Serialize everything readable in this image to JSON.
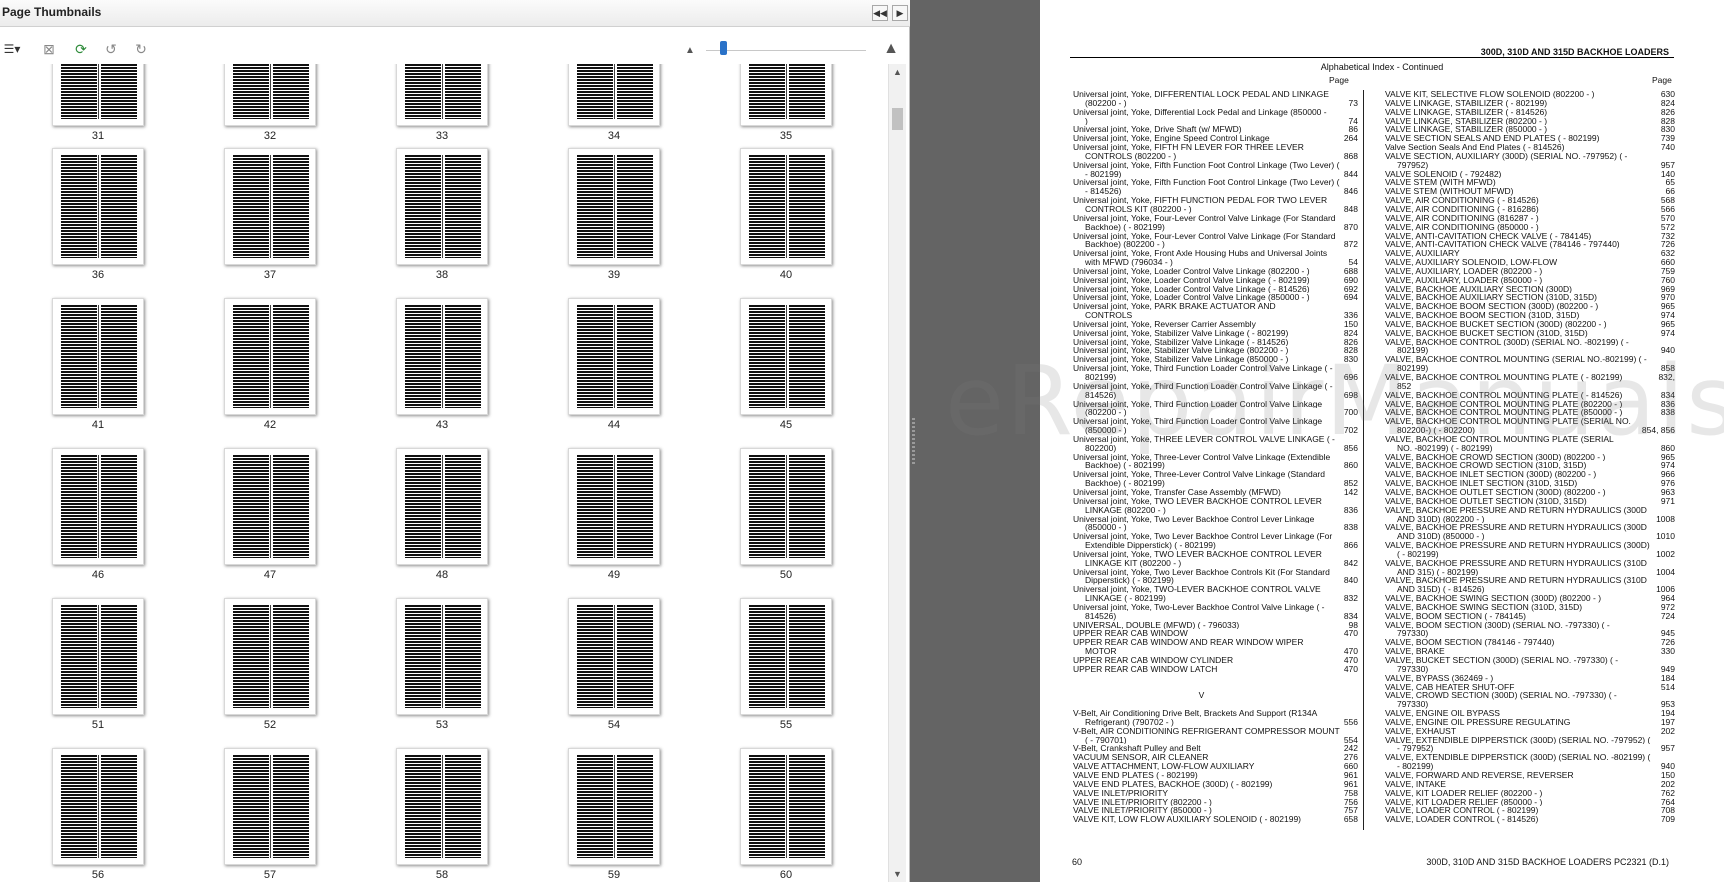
{
  "thumbnails_panel": {
    "title": "Page Thumbnails",
    "nav_left": "◀◀",
    "nav_right": "▶",
    "toolbar": [
      {
        "name": "options-menu-icon",
        "glyph": "☰▾"
      },
      {
        "name": "delete-pages-icon",
        "glyph": "⊠"
      },
      {
        "name": "insert-pages-icon",
        "glyph": "⟳"
      },
      {
        "name": "rotate-left-icon",
        "glyph": "↺"
      },
      {
        "name": "rotate-right-icon",
        "glyph": "↻"
      }
    ],
    "zoom_small_icon": "▲",
    "zoom_large_icon": "▲",
    "rows": [
      [
        "31",
        "32",
        "33",
        "34",
        "35"
      ],
      [
        "36",
        "37",
        "38",
        "39",
        "40"
      ],
      [
        "41",
        "42",
        "43",
        "44",
        "45"
      ],
      [
        "46",
        "47",
        "48",
        "49",
        "50"
      ],
      [
        "51",
        "52",
        "53",
        "54",
        "55"
      ],
      [
        "56",
        "57",
        "58",
        "59",
        "60"
      ]
    ]
  },
  "document": {
    "header": "300D, 310D AND 315D BACKHOE LOADERS",
    "subheader": "Alphabetical Index - Continued",
    "page_label": "Page",
    "footer_left": "60",
    "footer_right": "300D, 310D AND 315D BACKHOE LOADERS    PC2321    (D.1)",
    "watermark": "eRepairManuals",
    "left_column": [
      {
        "t": "Universal joint, Yoke, DIFFERENTIAL LOCK PEDAL AND LINKAGE",
        "p": ""
      },
      {
        "t": "(802200 - )",
        "p": "73",
        "c": true
      },
      {
        "t": "Universal joint, Yoke, Differential Lock Pedal and Linkage (850000 -",
        "p": ""
      },
      {
        "t": ")",
        "p": "74",
        "c": true
      },
      {
        "t": "Universal joint, Yoke, Drive Shaft (w/ MFWD)",
        "p": "86"
      },
      {
        "t": "Universal joint, Yoke, Engine Speed Control Linkage",
        "p": "264"
      },
      {
        "t": "Universal joint, Yoke, FIFTH FN LEVER FOR THREE LEVER",
        "p": ""
      },
      {
        "t": "CONTROLS (802200 - )",
        "p": "868",
        "c": true
      },
      {
        "t": "Universal joint, Yoke, Fifth Function Foot Control Linkage (Two Lever) (",
        "p": ""
      },
      {
        "t": "- 802199)",
        "p": "844",
        "c": true
      },
      {
        "t": "Universal joint, Yoke, Fifth Function Foot Control Linkage (Two Lever) (",
        "p": ""
      },
      {
        "t": "- 814526)",
        "p": "846",
        "c": true
      },
      {
        "t": "Universal joint, Yoke, FIFTH FUNCTION PEDAL FOR TWO LEVER",
        "p": ""
      },
      {
        "t": "CONTROLS KIT (802200 - )",
        "p": "848",
        "c": true
      },
      {
        "t": "Universal joint, Yoke, Four-Lever Control Valve Linkage (For Standard",
        "p": ""
      },
      {
        "t": "Backhoe) ( - 802199)",
        "p": "870",
        "c": true
      },
      {
        "t": "Universal joint, Yoke, Four-Lever Control Valve Linkage (For Standard",
        "p": ""
      },
      {
        "t": "Backhoe) (802200 - )",
        "p": "872",
        "c": true
      },
      {
        "t": "Universal joint, Yoke, Front Axle Housing Hubs and Universal Joints",
        "p": ""
      },
      {
        "t": "with MFWD (796034 - )",
        "p": "54",
        "c": true
      },
      {
        "t": "Universal joint, Yoke, Loader Control Valve Linkage (802200 - )",
        "p": "688"
      },
      {
        "t": "Universal joint, Yoke, Loader Control Valve Linkage ( - 802199)",
        "p": "690"
      },
      {
        "t": "Universal joint, Yoke, Loader Control Valve Linkage ( - 814526)",
        "p": "692"
      },
      {
        "t": "Universal joint, Yoke, Loader Control Valve Linkage (850000 - )",
        "p": "694"
      },
      {
        "t": "Universal joint, Yoke, PARK BRAKE ACTUATOR AND",
        "p": ""
      },
      {
        "t": "CONTROLS",
        "p": "336",
        "c": true
      },
      {
        "t": "Universal joint, Yoke, Reverser Carrier Assembly",
        "p": "150"
      },
      {
        "t": "Universal joint, Yoke, Stabilizer Valve Linkage ( - 802199)",
        "p": "824"
      },
      {
        "t": "Universal joint, Yoke, Stabilizer Valve Linkage ( - 814526)",
        "p": "826"
      },
      {
        "t": "Universal joint, Yoke, Stabilizer Valve Linkage (802200 - )",
        "p": "828"
      },
      {
        "t": "Universal joint, Yoke, Stabilizer Valve Linkage (850000 - )",
        "p": "830"
      },
      {
        "t": "Universal joint, Yoke, Third Function Loader Control Valve Linkage ( -",
        "p": ""
      },
      {
        "t": "802199)",
        "p": "696",
        "c": true
      },
      {
        "t": "Universal joint, Yoke, Third Function Loader Control Valve Linkage ( -",
        "p": ""
      },
      {
        "t": "814526)",
        "p": "698",
        "c": true
      },
      {
        "t": "Universal joint, Yoke, Third Function Loader Control Valve Linkage",
        "p": ""
      },
      {
        "t": "(802200 - )",
        "p": "700",
        "c": true
      },
      {
        "t": "Universal joint, Yoke, Third Function Loader Control Valve Linkage",
        "p": ""
      },
      {
        "t": "(850000 - )",
        "p": "702",
        "c": true
      },
      {
        "t": "Universal joint, Yoke, THREE LEVER CONTROL VALVE LINKAGE ( -",
        "p": ""
      },
      {
        "t": "802200)",
        "p": "856",
        "c": true
      },
      {
        "t": "Universal joint, Yoke, Three-Lever Control Valve Linkage (Extendible",
        "p": ""
      },
      {
        "t": "Backhoe) ( - 802199)",
        "p": "860",
        "c": true
      },
      {
        "t": "Universal joint, Yoke, Three-Lever Control Valve Linkage (Standard",
        "p": ""
      },
      {
        "t": "Backhoe) ( - 802199)",
        "p": "852",
        "c": true
      },
      {
        "t": "Universal joint, Yoke, Transfer Case Assembly (MFWD)",
        "p": "142"
      },
      {
        "t": "Universal joint, Yoke, TWO LEVER BACKHOE CONTROL LEVER",
        "p": ""
      },
      {
        "t": "LINKAGE (802200 - )",
        "p": "836",
        "c": true
      },
      {
        "t": "Universal joint, Yoke, Two Lever Backhoe Control Lever Linkage",
        "p": ""
      },
      {
        "t": "(850000 - )",
        "p": "838",
        "c": true
      },
      {
        "t": "Universal joint, Yoke, Two Lever Backhoe Control Lever Linkage (For",
        "p": ""
      },
      {
        "t": "Extendible Dipperstick) ( - 802199)",
        "p": "866",
        "c": true
      },
      {
        "t": "Universal joint, Yoke, TWO LEVER BACKHOE CONTROL LEVER",
        "p": ""
      },
      {
        "t": "LINKAGE KIT (802200 - )",
        "p": "842",
        "c": true
      },
      {
        "t": "Universal joint, Yoke, Two Lever Backhoe Controls Kit (For Standard",
        "p": ""
      },
      {
        "t": "Dipperstick) ( - 802199)",
        "p": "840",
        "c": true
      },
      {
        "t": "Universal joint, Yoke, TWO-LEVER BACKHOE CONTROL VALVE",
        "p": ""
      },
      {
        "t": "LINKAGE ( - 802199)",
        "p": "832",
        "c": true
      },
      {
        "t": "Universal joint, Yoke, Two-Lever Backhoe Control Valve Linkage ( -",
        "p": ""
      },
      {
        "t": "814526)",
        "p": "834",
        "c": true
      },
      {
        "t": "UNIVERSAL, DOUBLE (MFWD) ( - 796033)",
        "p": "98"
      },
      {
        "t": "UPPER REAR CAB WINDOW",
        "p": "470"
      },
      {
        "t": "UPPER REAR CAB WINDOW AND REAR WINDOW WIPER",
        "p": ""
      },
      {
        "t": "MOTOR",
        "p": "470",
        "c": true
      },
      {
        "t": "UPPER REAR CAB WINDOW CYLINDER",
        "p": "470"
      },
      {
        "t": "UPPER REAR CAB WINDOW LATCH",
        "p": "470"
      },
      {
        "blank": true
      },
      {
        "blank": true
      },
      {
        "hdr": "V"
      },
      {
        "blank": true
      },
      {
        "t": "V-Belt, Air Conditioning Drive Belt, Brackets And Support (R134A",
        "p": ""
      },
      {
        "t": "Refrigerant) (790702 - )",
        "p": "556",
        "c": true
      },
      {
        "t": "V-Belt, AIR CONDITIONING REFRIGERANT COMPRESSOR MOUNT",
        "p": ""
      },
      {
        "t": "( - 790701)",
        "p": "554",
        "c": true
      },
      {
        "t": "V-Belt, Crankshaft Pulley and Belt",
        "p": "242"
      },
      {
        "t": "VACUUM SENSOR, AIR CLEANER",
        "p": "276"
      },
      {
        "t": "VALVE ATTACHMENT, LOW-FLOW AUXILIARY",
        "p": "660"
      },
      {
        "t": "VALVE END PLATES ( - 802199)",
        "p": "961"
      },
      {
        "t": "VALVE END PLATES, BACKHOE (300D) ( - 802199)",
        "p": "961"
      },
      {
        "t": "VALVE INLET/PRIORITY",
        "p": "758"
      },
      {
        "t": "VALVE INLET/PRIORITY (802200 - )",
        "p": "756"
      },
      {
        "t": "VALVE INLET/PRIORITY (850000 - )",
        "p": "757"
      },
      {
        "t": "VALVE KIT, LOW FLOW AUXILIARY SOLENOID ( - 802199)",
        "p": "658"
      }
    ],
    "right_column": [
      {
        "t": "VALVE KIT, SELECTIVE FLOW SOLENOID (802200 - )",
        "p": "630"
      },
      {
        "t": "VALVE LINKAGE, STABILIZER ( - 802199)",
        "p": "824"
      },
      {
        "t": "VALVE LINKAGE, STABILIZER ( - 814526)",
        "p": "826"
      },
      {
        "t": "VALVE LINKAGE, STABILIZER (802200 - )",
        "p": "828"
      },
      {
        "t": "VALVE LINKAGE, STABILIZER (850000 - )",
        "p": "830"
      },
      {
        "t": "VALVE SECTION SEALS AND END PLATES ( - 802199)",
        "p": "739"
      },
      {
        "t": "Valve Section Seals And End Plates ( - 814526)",
        "p": "740"
      },
      {
        "t": "VALVE SECTION, AUXILIARY (300D) (SERIAL NO. -797952) ( -",
        "p": ""
      },
      {
        "t": "797952)",
        "p": "957",
        "c": true
      },
      {
        "t": "VALVE SOLENOID ( - 792482)",
        "p": "140"
      },
      {
        "t": "VALVE STEM (WITH MFWD)",
        "p": "65"
      },
      {
        "t": "VALVE STEM (WITHOUT MFWD)",
        "p": "66"
      },
      {
        "t": "VALVE, AIR CONDITIONING ( - 814526)",
        "p": "568"
      },
      {
        "t": "VALVE, AIR CONDITIONING ( - 816286)",
        "p": "566"
      },
      {
        "t": "VALVE, AIR CONDITIONING (816287 - )",
        "p": "570"
      },
      {
        "t": "VALVE, AIR CONDITIONING (850000 - )",
        "p": "572"
      },
      {
        "t": "VALVE, ANTI-CAVITATION CHECK VALVE ( - 784145)",
        "p": "732"
      },
      {
        "t": "VALVE, ANTI-CAVITATION CHECK VALVE (784146 - 797440)",
        "p": "726"
      },
      {
        "t": "VALVE, AUXILIARY",
        "p": "632"
      },
      {
        "t": "VALVE, AUXILIARY SOLENOID, LOW-FLOW",
        "p": "660"
      },
      {
        "t": "VALVE, AUXILIARY, LOADER (802200 - )",
        "p": "759"
      },
      {
        "t": "VALVE, AUXILIARY, LOADER (850000 - )",
        "p": "760"
      },
      {
        "t": "VALVE, BACKHOE AUXILIARY SECTION (300D)",
        "p": "969"
      },
      {
        "t": "VALVE, BACKHOE AUXILIARY SECTION (310D, 315D)",
        "p": "970"
      },
      {
        "t": "VALVE, BACKHOE BOOM SECTION (300D) (802200 - )",
        "p": "965"
      },
      {
        "t": "VALVE, BACKHOE BOOM SECTION (310D, 315D)",
        "p": "974"
      },
      {
        "t": "VALVE, BACKHOE BUCKET SECTION (300D) (802200 - )",
        "p": "965"
      },
      {
        "t": "VALVE, BACKHOE BUCKET SECTION (310D, 315D)",
        "p": "974"
      },
      {
        "t": "VALVE, BACKHOE CONTROL (300D) (SERIAL NO. -802199) ( -",
        "p": ""
      },
      {
        "t": "802199)",
        "p": "940",
        "c": true
      },
      {
        "t": "VALVE, BACKHOE CONTROL MOUNTING (SERIAL NO.-802199) ( -",
        "p": ""
      },
      {
        "t": "802199)",
        "p": "858",
        "c": true
      },
      {
        "t": "VALVE, BACKHOE CONTROL MOUNTING PLATE ( - 802199)",
        "p": "832,"
      },
      {
        "t": "852",
        "p": "",
        "c": true
      },
      {
        "t": "VALVE, BACKHOE CONTROL MOUNTING PLATE ( - 814526)",
        "p": "834"
      },
      {
        "t": "VALVE, BACKHOE CONTROL MOUNTING PLATE (802200 - )",
        "p": "836"
      },
      {
        "t": "VALVE, BACKHOE CONTROL MOUNTING PLATE (850000 - )",
        "p": "838"
      },
      {
        "t": "VALVE, BACKHOE CONTROL MOUNTING PLATE (SERIAL NO.",
        "p": ""
      },
      {
        "t": "802200-) ( - 802200)",
        "p": "854, 856",
        "c": true
      },
      {
        "t": "VALVE, BACKHOE CONTROL MOUNTING PLATE (SERIAL",
        "p": ""
      },
      {
        "t": "NO. -802199) ( - 802199)",
        "p": "860",
        "c": true
      },
      {
        "t": "VALVE, BACKHOE CROWD SECTION (300D) (802200 - )",
        "p": "965"
      },
      {
        "t": "VALVE, BACKHOE CROWD SECTION (310D, 315D)",
        "p": "974"
      },
      {
        "t": "VALVE, BACKHOE INLET SECTION (300D) (802200 - )",
        "p": "966"
      },
      {
        "t": "VALVE, BACKHOE INLET SECTION (310D, 315D)",
        "p": "976"
      },
      {
        "t": "VALVE, BACKHOE OUTLET SECTION (300D) (802200 - )",
        "p": "963"
      },
      {
        "t": "VALVE, BACKHOE OUTLET SECTION (310D, 315D)",
        "p": "971"
      },
      {
        "t": "VALVE, BACKHOE PRESSURE AND RETURN HYDRAULICS (300D",
        "p": ""
      },
      {
        "t": "AND 310D) (802200 - )",
        "p": "1008",
        "c": true
      },
      {
        "t": "VALVE, BACKHOE PRESSURE AND RETURN HYDRAULICS (300D",
        "p": ""
      },
      {
        "t": "AND 310D) (850000 - )",
        "p": "1010",
        "c": true
      },
      {
        "t": "VALVE, BACKHOE PRESSURE AND RETURN HYDRAULICS (300D)",
        "p": ""
      },
      {
        "t": "( - 802199)",
        "p": "1002",
        "c": true
      },
      {
        "t": "VALVE, BACKHOE PRESSURE AND RETURN HYDRAULICS (310D",
        "p": ""
      },
      {
        "t": "AND 315) ( - 802199)",
        "p": "1004",
        "c": true
      },
      {
        "t": "VALVE, BACKHOE PRESSURE AND RETURN HYDRAULICS (310D",
        "p": ""
      },
      {
        "t": "AND 315D) ( - 814526)",
        "p": "1006",
        "c": true
      },
      {
        "t": "VALVE, BACKHOE SWING SECTION (300D) (802200 - )",
        "p": "964"
      },
      {
        "t": "VALVE, BACKHOE SWING SECTION (310D, 315D)",
        "p": "972"
      },
      {
        "t": "VALVE, BOOM SECTION ( - 784145)",
        "p": "724"
      },
      {
        "t": "VALVE, BOOM SECTION (300D) (SERIAL NO. -797330) ( -",
        "p": ""
      },
      {
        "t": "797330)",
        "p": "945",
        "c": true
      },
      {
        "t": "VALVE, BOOM SECTION (784146 - 797440)",
        "p": "726"
      },
      {
        "t": "VALVE, BRAKE",
        "p": "330"
      },
      {
        "t": "VALVE, BUCKET SECTION (300D) (SERIAL NO. -797330) ( -",
        "p": ""
      },
      {
        "t": "797330)",
        "p": "949",
        "c": true
      },
      {
        "t": "VALVE, BYPASS (362469 - )",
        "p": "184"
      },
      {
        "t": "VALVE, CAB HEATER SHUT-OFF",
        "p": "514"
      },
      {
        "t": "VALVE, CROWD SECTION (300D) (SERIAL NO. -797330) ( -",
        "p": ""
      },
      {
        "t": "797330)",
        "p": "953",
        "c": true
      },
      {
        "t": "VALVE, ENGINE OIL BYPASS",
        "p": "194"
      },
      {
        "t": "VALVE, ENGINE OIL PRESSURE REGULATING",
        "p": "197"
      },
      {
        "t": "VALVE, EXHAUST",
        "p": "202"
      },
      {
        "t": "VALVE, EXTENDIBLE DIPPERSTICK (300D) (SERIAL NO. -797952) (",
        "p": ""
      },
      {
        "t": "- 797952)",
        "p": "957",
        "c": true
      },
      {
        "t": "VALVE, EXTENDIBLE DIPPERSTICK (300D) (SERIAL NO. -802199) (",
        "p": ""
      },
      {
        "t": "- 802199)",
        "p": "940",
        "c": true
      },
      {
        "t": "VALVE, FORWARD AND REVERSE, REVERSER",
        "p": "150"
      },
      {
        "t": "VALVE, INTAKE",
        "p": "202"
      },
      {
        "t": "VALVE, KIT LOADER RELIEF (802200 - )",
        "p": "762"
      },
      {
        "t": "VALVE, KIT LOADER RELIEF (850000 - )",
        "p": "764"
      },
      {
        "t": "VALVE, LOADER CONTROL ( - 802199)",
        "p": "708"
      },
      {
        "t": "VALVE, LOADER CONTROL ( - 814526)",
        "p": "709"
      }
    ]
  }
}
